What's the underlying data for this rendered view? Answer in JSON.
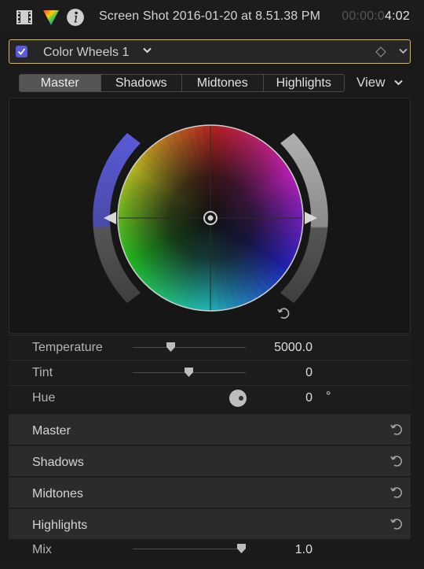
{
  "header": {
    "title": "Screen Shot 2016-01-20 at 8.51.38 PM",
    "timecode_dim": "00:00:0",
    "timecode_bright": "4:02",
    "icons": [
      "film-icon",
      "color-inspector-icon",
      "info-icon"
    ]
  },
  "effect": {
    "enabled": true,
    "name": "Color Wheels 1",
    "icons": [
      "checkbox-icon",
      "chevron-down-icon",
      "keyframe-diamond-icon",
      "chevron-down-icon"
    ]
  },
  "tabs": [
    {
      "label": "Master",
      "active": true
    },
    {
      "label": "Shadows",
      "active": false
    },
    {
      "label": "Midtones",
      "active": false
    },
    {
      "label": "Highlights",
      "active": false
    }
  ],
  "view_menu": {
    "label": "View"
  },
  "wheel": {
    "saturation_color": "#5a5ad8",
    "brightness_color": "#9a9a9a"
  },
  "params": [
    {
      "label": "Temperature",
      "value": "5000.0",
      "slider_fraction": 0.35
    },
    {
      "label": "Tint",
      "value": "0",
      "slider_fraction": 0.5
    },
    {
      "label": "Hue",
      "value": "0",
      "unit": "°"
    }
  ],
  "sections": [
    {
      "label": "Master"
    },
    {
      "label": "Shadows"
    },
    {
      "label": "Midtones"
    },
    {
      "label": "Highlights"
    }
  ],
  "mix": {
    "label": "Mix",
    "value": "1.0",
    "slider_fraction": 1.0
  },
  "colors": {
    "accent_border": "#d8b64a",
    "checkbox": "#5b5bd8"
  }
}
